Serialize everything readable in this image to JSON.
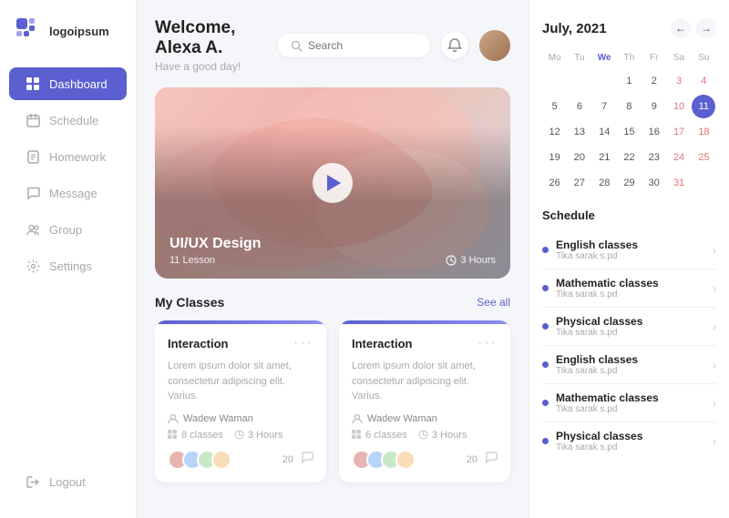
{
  "logo": {
    "text": "logoipsum"
  },
  "nav": {
    "items": [
      {
        "id": "dashboard",
        "label": "Dashboard",
        "icon": "grid",
        "active": true
      },
      {
        "id": "schedule",
        "label": "Schedule",
        "icon": "calendar"
      },
      {
        "id": "homework",
        "label": "Homework",
        "icon": "book"
      },
      {
        "id": "message",
        "label": "Message",
        "icon": "chat"
      },
      {
        "id": "group",
        "label": "Group",
        "icon": "users"
      },
      {
        "id": "settings",
        "label": "Settings",
        "icon": "gear"
      }
    ],
    "logout": "Logout"
  },
  "header": {
    "welcome_title": "Welcome, Alexa A.",
    "welcome_sub": "Have a good day!",
    "search_placeholder": "Search"
  },
  "hero": {
    "title": "UI/UX Design",
    "lessons": "11 Lesson",
    "duration": "3 Hours"
  },
  "classes": {
    "section_title": "My Classes",
    "see_all": "See all",
    "cards": [
      {
        "title": "Interaction",
        "desc": "Lorem ipsum dolor sit amet, consectetur adipiscing elit. Varius.",
        "teacher": "Wadew Waman",
        "classes": "8 classes",
        "hours": "3 Hours",
        "count": "20"
      },
      {
        "title": "Interaction",
        "desc": "Lorem ipsum dolor sit amet, consectetur adipiscing elit. Varius.",
        "teacher": "Wadew Waman",
        "classes": "6 classes",
        "hours": "3 Hours",
        "count": "20"
      }
    ]
  },
  "calendar": {
    "title": "July, 2021",
    "day_labels": [
      "Mo",
      "Tu",
      "We",
      "Th",
      "Fr",
      "Sa",
      "Su"
    ],
    "weeks": [
      [
        "",
        "",
        "",
        "1",
        "2",
        "3",
        "4"
      ],
      [
        "5",
        "6",
        "7",
        "8",
        "9",
        "10",
        "11"
      ],
      [
        "12",
        "13",
        "14",
        "15",
        "16",
        "17",
        "18"
      ],
      [
        "19",
        "20",
        "21",
        "22",
        "23",
        "24",
        "25"
      ],
      [
        "26",
        "27",
        "28",
        "29",
        "30",
        "31",
        ""
      ]
    ],
    "today": "11",
    "weekends": [
      "3",
      "4",
      "10",
      "11",
      "17",
      "18",
      "24",
      "25",
      "31"
    ]
  },
  "schedule": {
    "title": "Schedule",
    "items": [
      {
        "name": "English classes",
        "teacher": "Tika sarak s.pd"
      },
      {
        "name": "Mathematic classes",
        "teacher": "Tika sarak s.pd"
      },
      {
        "name": "Physical classes",
        "teacher": "Tika sarak s.pd"
      },
      {
        "name": "English classes",
        "teacher": "Tika sarak s.pd"
      },
      {
        "name": "Mathematic classes",
        "teacher": "Tika sarak s.pd"
      },
      {
        "name": "Physical classes",
        "teacher": "Tika sarak s.pd"
      }
    ]
  }
}
